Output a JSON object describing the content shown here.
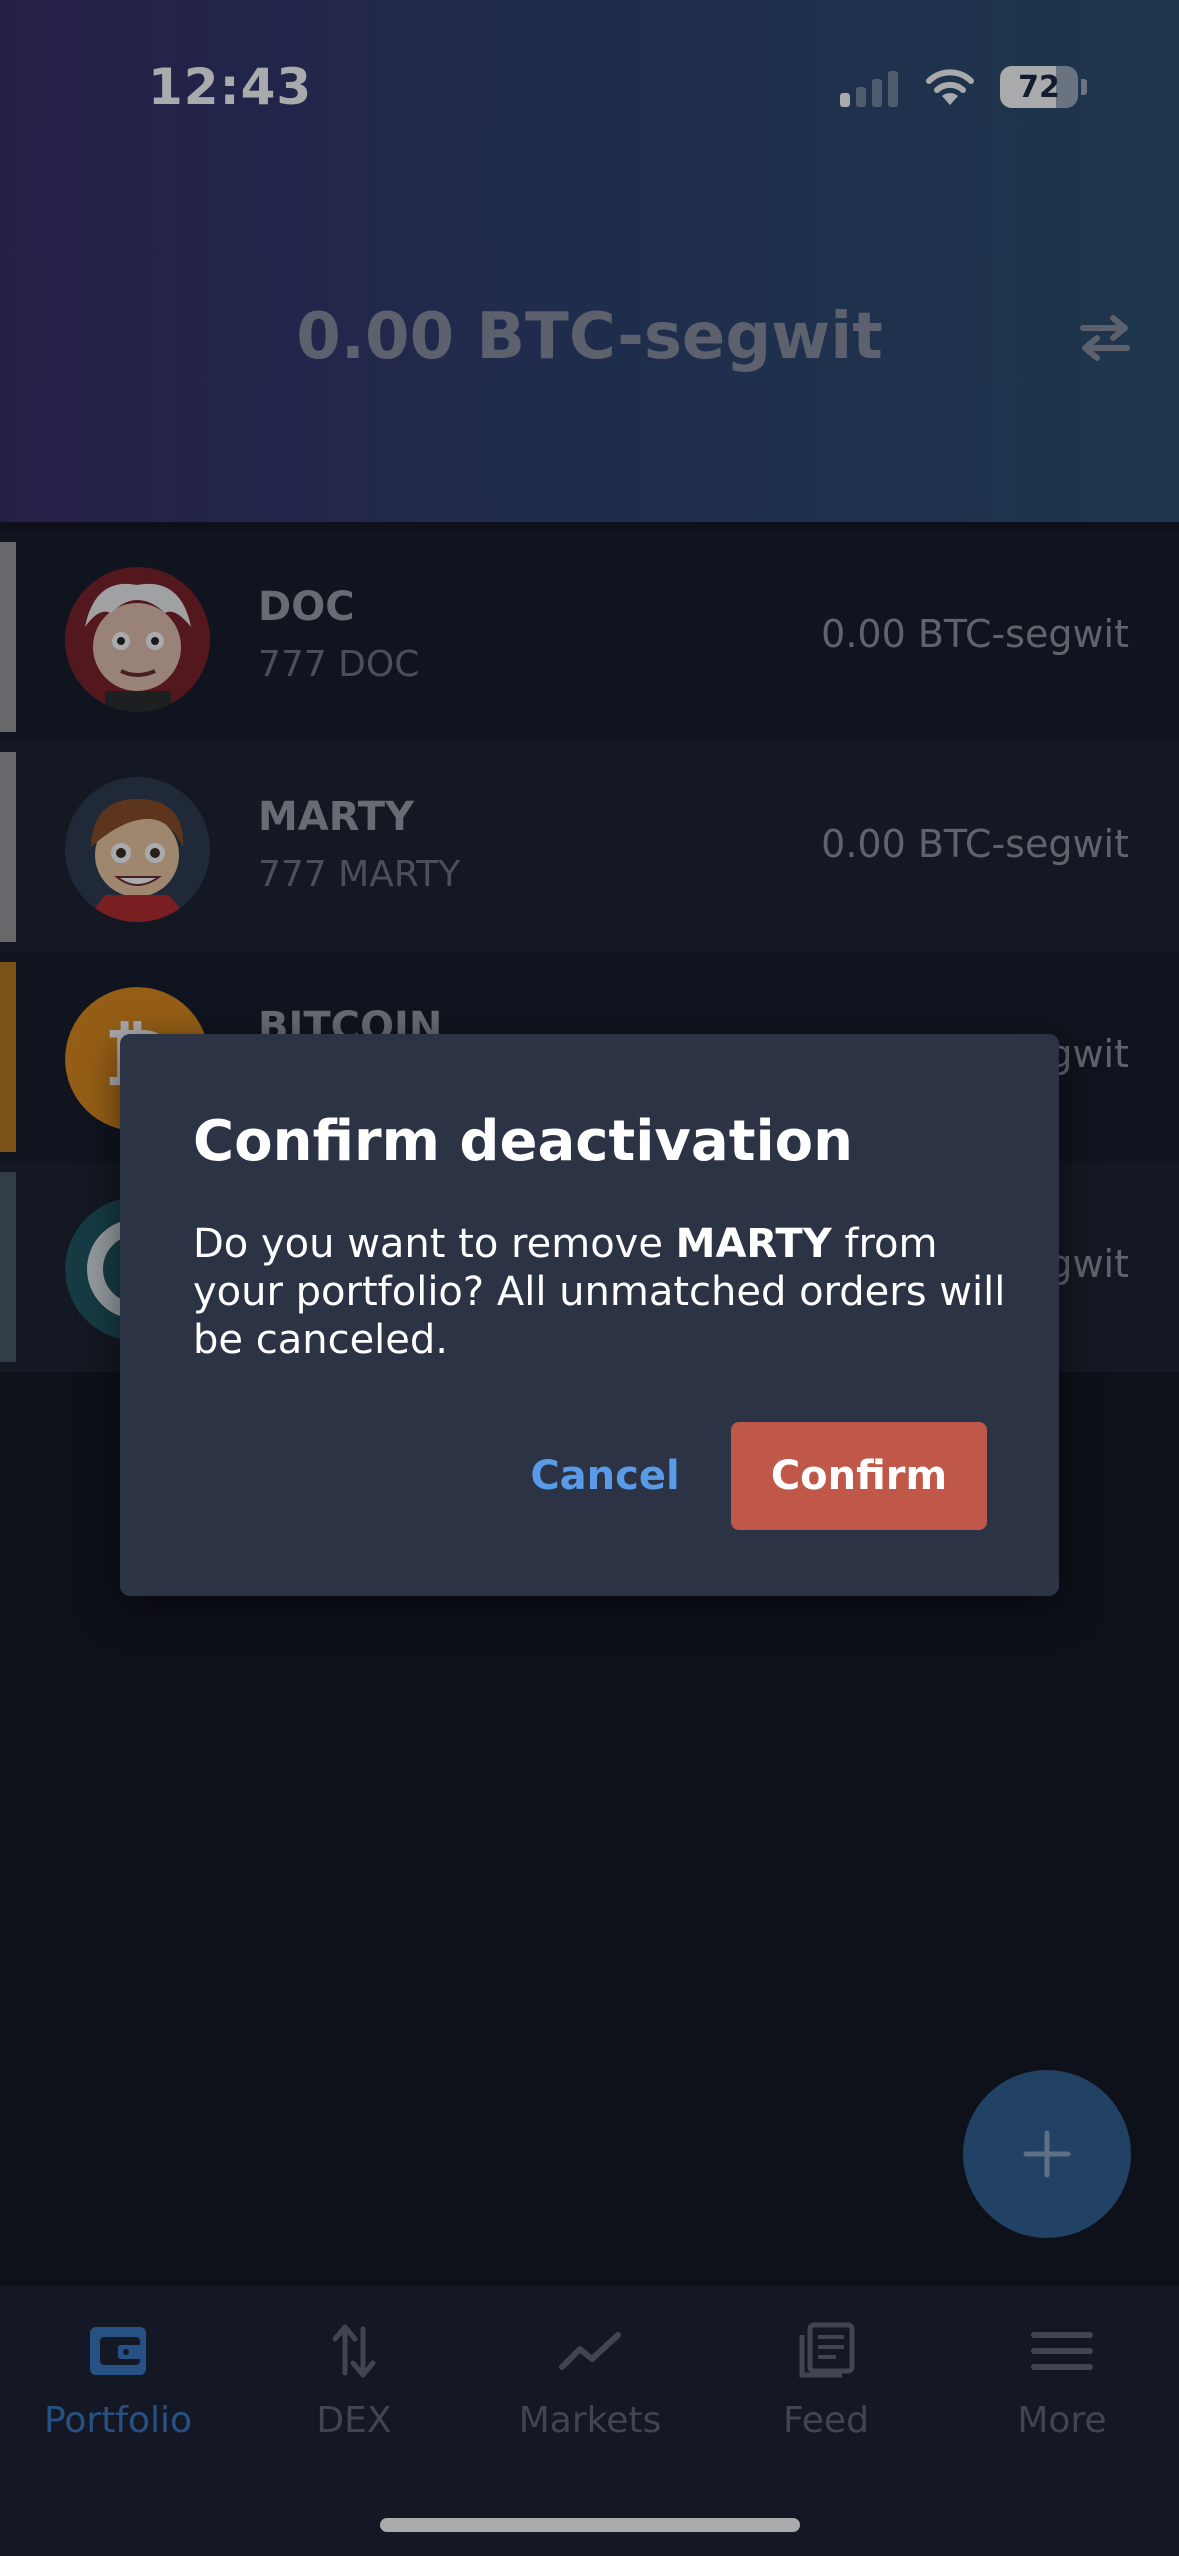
{
  "status_bar": {
    "time": "12:43",
    "battery": "72"
  },
  "header": {
    "balance": "0.00 BTC-segwit"
  },
  "coins": [
    {
      "name": "DOC",
      "amount": "777 DOC",
      "value": "0.00 BTC-segwit",
      "marker_color": "#9a9a9a"
    },
    {
      "name": "MARTY",
      "amount": "777 MARTY",
      "value": "0.00 BTC-segwit",
      "marker_color": "#9a9a9a"
    },
    {
      "name": "BITCOIN",
      "amount": "",
      "value": "0.00 BTC-segwit",
      "marker_color": "#b87a1e"
    },
    {
      "name": "",
      "amount": "",
      "value": "0.00 BTC-segwit",
      "marker_color": "#4a5866"
    }
  ],
  "dialog": {
    "title": "Confirm deactivation",
    "body_prefix": "Do you want to remove ",
    "body_coin": "MARTY",
    "body_suffix": " from your portfolio? All unmatched orders will be canceled.",
    "cancel_label": "Cancel",
    "confirm_label": "Confirm"
  },
  "nav": {
    "items": [
      {
        "label": "Portfolio",
        "icon": "wallet-icon",
        "active": true
      },
      {
        "label": "DEX",
        "icon": "swap-vertical-icon"
      },
      {
        "label": "Markets",
        "icon": "trend-line-icon"
      },
      {
        "label": "Feed",
        "icon": "feed-icon"
      },
      {
        "label": "More",
        "icon": "menu-icon"
      }
    ]
  },
  "colors": {
    "accent": "#3a77c0",
    "confirm": "#c0584a",
    "cancel": "#5a9be8",
    "dialog_bg": "#2c3344"
  }
}
